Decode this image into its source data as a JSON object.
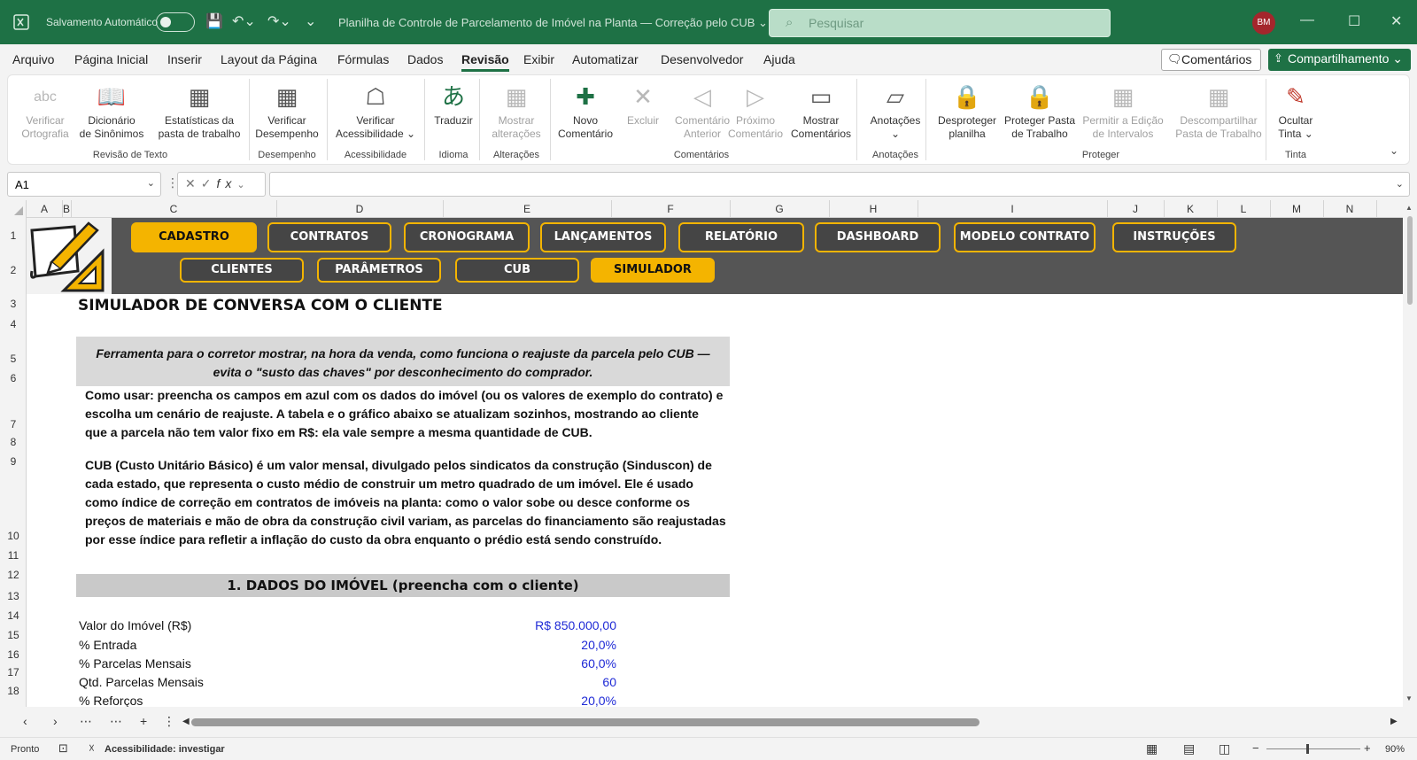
{
  "titlebar": {
    "autosave_label": "Salvamento Automático",
    "doc_title": "Planilha de Controle de Parcelamento de Imóvel na Planta — Correção pelo CUB ⌄",
    "search_placeholder": "Pesquisar",
    "user_initials": "BM"
  },
  "menu": {
    "items": [
      "Arquivo",
      "Página Inicial",
      "Inserir",
      "Layout da Página",
      "Fórmulas",
      "Dados",
      "Revisão",
      "Exibir",
      "Automatizar",
      "Desenvolvedor",
      "Ajuda"
    ],
    "active": "Revisão",
    "comments_label": "Comentários",
    "share_label": "Compartilhamento ⌄"
  },
  "ribbon": {
    "buttons": [
      {
        "l1": "Verificar",
        "l2": "Ortografia",
        "icon": "spellcheck-icon",
        "glyph": "abc",
        "disabled": true
      },
      {
        "l1": "Dicionário",
        "l2": "de Sinônimos",
        "icon": "thesaurus-icon",
        "glyph": "📖",
        "disabled": false
      },
      {
        "l1": "Estatísticas da",
        "l2": "pasta de trabalho",
        "icon": "statistics-icon",
        "glyph": "▦",
        "disabled": false
      },
      {
        "l1": "Verificar",
        "l2": "Desempenho",
        "icon": "performance-icon",
        "glyph": "▦",
        "disabled": false
      },
      {
        "l1": "Verificar",
        "l2": "Acessibilidade ⌄",
        "icon": "accessibility-icon",
        "glyph": "☖",
        "disabled": false
      },
      {
        "l1": "Traduzir",
        "l2": "",
        "icon": "translate-icon",
        "glyph": "あ",
        "disabled": false
      },
      {
        "l1": "Mostrar",
        "l2": "alterações",
        "icon": "show-changes-icon",
        "glyph": "▦",
        "disabled": true
      },
      {
        "l1": "Novo",
        "l2": "Comentário",
        "icon": "new-comment-icon",
        "glyph": "✚",
        "disabled": false
      },
      {
        "l1": "Excluir",
        "l2": "",
        "icon": "delete-comment-icon",
        "glyph": "✕",
        "disabled": true
      },
      {
        "l1": "Comentário",
        "l2": "Anterior",
        "icon": "previous-comment-icon",
        "glyph": "◁",
        "disabled": true
      },
      {
        "l1": "Próximo",
        "l2": "Comentário",
        "icon": "next-comment-icon",
        "glyph": "▷",
        "disabled": true
      },
      {
        "l1": "Mostrar",
        "l2": "Comentários",
        "icon": "show-comments-icon",
        "glyph": "▭",
        "disabled": false
      },
      {
        "l1": "Anotações",
        "l2": "⌄",
        "icon": "notes-icon",
        "glyph": "▱",
        "disabled": false
      },
      {
        "l1": "Desproteger",
        "l2": "planilha",
        "icon": "unprotect-sheet-icon",
        "glyph": "🔒",
        "disabled": false
      },
      {
        "l1": "Proteger Pasta",
        "l2": "de Trabalho",
        "icon": "protect-workbook-icon",
        "glyph": "🔒",
        "disabled": false
      },
      {
        "l1": "Permitir a Edição",
        "l2": "de Intervalos",
        "icon": "allow-edit-ranges-icon",
        "glyph": "▦",
        "disabled": true
      },
      {
        "l1": "Descompartilhar",
        "l2": "Pasta de Trabalho",
        "icon": "unshare-workbook-icon",
        "glyph": "▦",
        "disabled": true
      },
      {
        "l1": "Ocultar",
        "l2": "Tinta ⌄",
        "icon": "hide-ink-icon",
        "glyph": "✎",
        "disabled": false
      }
    ],
    "groups": [
      "Revisão de Texto",
      "Desempenho",
      "Acessibilidade",
      "Idioma",
      "Alterações",
      "Comentários",
      "Anotações",
      "Proteger",
      "Tinta"
    ]
  },
  "formula_bar": {
    "name_box": "A1",
    "formula": ""
  },
  "columns": [
    "A",
    "B",
    "C",
    "D",
    "E",
    "F",
    "G",
    "H",
    "I",
    "J",
    "K",
    "L",
    "M",
    "N"
  ],
  "rows": [
    "1",
    "2",
    "3",
    "4",
    "5",
    "6",
    "7",
    "8",
    "9",
    "10",
    "11",
    "12",
    "13",
    "14",
    "15",
    "16",
    "17",
    "18"
  ],
  "nav": {
    "top": [
      {
        "label": "CADASTRO",
        "active": true
      },
      {
        "label": "CONTRATOS",
        "active": false
      },
      {
        "label": "CRONOGRAMA",
        "active": false
      },
      {
        "label": "LANÇAMENTOS",
        "active": false
      },
      {
        "label": "RELATÓRIO",
        "active": false
      },
      {
        "label": "DASHBOARD",
        "active": false
      },
      {
        "label": "MODELO CONTRATO",
        "active": false
      },
      {
        "label": "INSTRUÇÕES",
        "active": false
      }
    ],
    "sub": [
      {
        "label": "CLIENTES",
        "active": false
      },
      {
        "label": "PARÂMETROS",
        "active": false
      },
      {
        "label": "CUB",
        "active": false
      },
      {
        "label": "SIMULADOR",
        "active": true
      }
    ]
  },
  "sheet": {
    "title": "SIMULADOR DE CONVERSA COM O CLIENTE",
    "banner_l1": "Ferramenta para o corretor mostrar, na hora da venda, como funciona o reajuste da parcela pelo CUB —",
    "banner_l2": "evita o \"susto das chaves\" por desconhecimento do comprador.",
    "howto": [
      "Como usar: preencha os campos em azul com os dados do imóvel (ou os valores de exemplo do contrato) e",
      "escolha um cenário de reajuste. A tabela e o gráfico abaixo se atualizam sozinhos, mostrando ao cliente",
      "que a parcela não tem valor fixo em R$: ela vale sempre a mesma quantidade de CUB."
    ],
    "cub": [
      "CUB (Custo Unitário Básico) é um valor mensal, divulgado pelos sindicatos da construção (Sinduscon) de",
      "cada estado, que representa o custo médio de construir um metro quadrado de um imóvel. Ele é usado",
      "como índice de correção em contratos de imóveis na planta: como o valor sobe ou desce conforme os",
      "preços de materiais e mão de obra da construção civil variam, as parcelas do financiamento são reajustadas",
      "por esse índice para refletir a inflação do custo da obra enquanto o prédio está sendo construído."
    ],
    "section1": "1. DADOS DO IMÓVEL (preencha com o cliente)",
    "fields": [
      {
        "label": "Valor do Imóvel (R$)",
        "value": "R$ 850.000,00"
      },
      {
        "label": "% Entrada",
        "value": "20,0%"
      },
      {
        "label": "% Parcelas Mensais",
        "value": "60,0%"
      },
      {
        "label": "Qtd. Parcelas Mensais",
        "value": "60"
      },
      {
        "label": "% Reforços",
        "value": "20,0%"
      }
    ]
  },
  "statusbar": {
    "ready": "Pronto",
    "accessibility": "Acessibilidade: investigar",
    "zoom": "90%"
  }
}
